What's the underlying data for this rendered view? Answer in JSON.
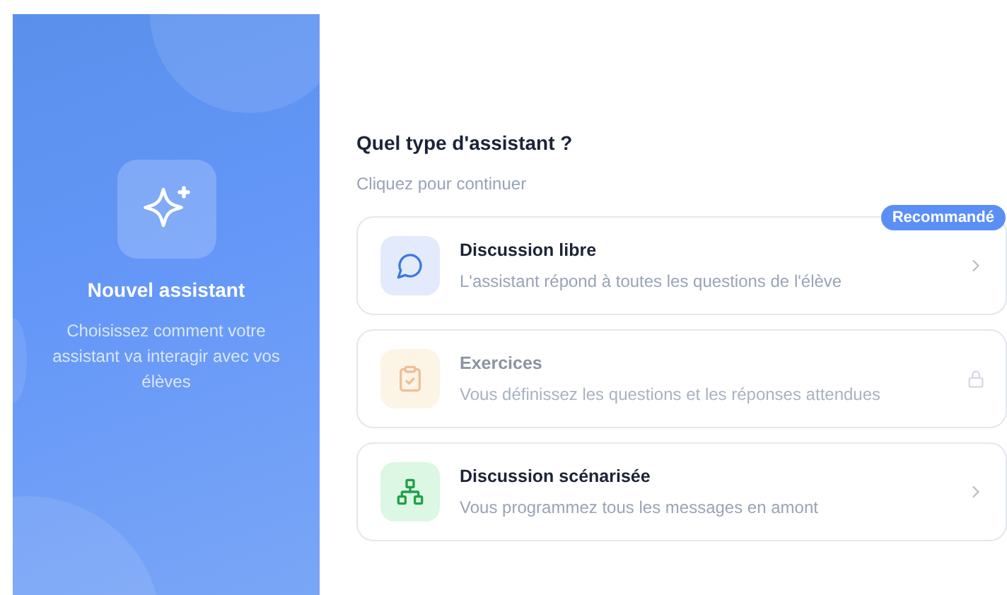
{
  "intro": {
    "title": "Nouvel assistant",
    "description": "Choisissez comment votre assistant va interagir avec vos élèves"
  },
  "heading": "Quel type d'assistant ?",
  "subheading": "Cliquez pour continuer",
  "options": [
    {
      "kind": "chat",
      "title": "Discussion libre",
      "description": "L'assistant répond à toutes les questions de l'élève",
      "badge": "Recommandé",
      "disabled": false
    },
    {
      "kind": "exercise",
      "title": "Exercices",
      "description": "Vous définissez les questions et les réponses attendues",
      "disabled": true
    },
    {
      "kind": "flow",
      "title": "Discussion scénarisée",
      "description": "Vous programmez tous les messages en amont",
      "disabled": false
    }
  ]
}
